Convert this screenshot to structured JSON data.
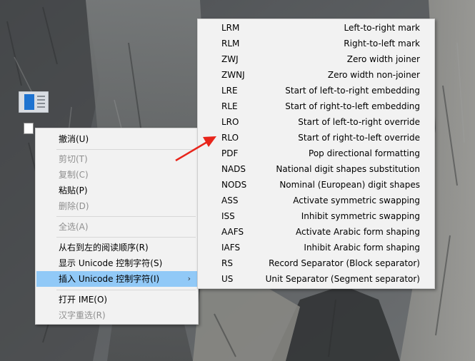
{
  "context_menu": {
    "items": [
      {
        "label": "撤消(U)",
        "enabled": true
      },
      {
        "label": "剪切(T)",
        "enabled": false
      },
      {
        "label": "复制(C)",
        "enabled": false
      },
      {
        "label": "粘贴(P)",
        "enabled": true
      },
      {
        "label": "删除(D)",
        "enabled": false
      },
      {
        "label": "全选(A)",
        "enabled": false
      },
      {
        "label": "从右到左的阅读顺序(R)",
        "enabled": true
      },
      {
        "label": "显示 Unicode 控制字符(S)",
        "enabled": true
      },
      {
        "label": "插入 Unicode 控制字符(I)",
        "enabled": true,
        "highlighted": true,
        "has_submenu": true,
        "arrow": "›"
      },
      {
        "label": "打开 IME(O)",
        "enabled": true
      },
      {
        "label": "汉字重选(R)",
        "enabled": false
      }
    ]
  },
  "submenu": {
    "items": [
      {
        "code": "LRM",
        "desc": "Left-to-right mark"
      },
      {
        "code": "RLM",
        "desc": "Right-to-left mark"
      },
      {
        "code": "ZWJ",
        "desc": "Zero width joiner"
      },
      {
        "code": "ZWNJ",
        "desc": "Zero width non-joiner"
      },
      {
        "code": "LRE",
        "desc": "Start of left-to-right embedding"
      },
      {
        "code": "RLE",
        "desc": "Start of right-to-left embedding"
      },
      {
        "code": "LRO",
        "desc": "Start of left-to-right override"
      },
      {
        "code": "RLO",
        "desc": "Start of right-to-left override"
      },
      {
        "code": "PDF",
        "desc": "Pop directional formatting"
      },
      {
        "code": "NADS",
        "desc": "National digit shapes substitution"
      },
      {
        "code": "NODS",
        "desc": "Nominal (European) digit shapes"
      },
      {
        "code": "ASS",
        "desc": "Activate symmetric swapping"
      },
      {
        "code": "ISS",
        "desc": "Inhibit symmetric swapping"
      },
      {
        "code": "AAFS",
        "desc": "Activate Arabic form shaping"
      },
      {
        "code": "IAFS",
        "desc": "Inhibit Arabic form shaping"
      },
      {
        "code": "RS",
        "desc": "Record Separator (Block separator)"
      },
      {
        "code": "US",
        "desc": "Unit Separator (Segment separator)"
      }
    ]
  },
  "annotation": {
    "points_to": "RLO",
    "color": "#e8251b"
  },
  "desktop": {
    "icon": "document-icon"
  }
}
